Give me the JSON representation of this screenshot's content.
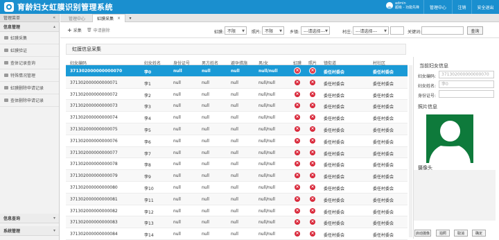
{
  "app": {
    "title": "育龄妇女虹膜识别管理系统"
  },
  "user": {
    "name": "admin",
    "role": "超级 - 功能先锋"
  },
  "topnav": [
    "管理中心",
    "注销",
    "安全退出"
  ],
  "sidebar": {
    "header": "管理菜单",
    "collapse_icon": "«",
    "section_main": "信息管理",
    "items": [
      "虹膜采集",
      "虹膜验证",
      "查体记录查询",
      "特殊情况管理",
      "虹膜删除申请记录",
      "查体删除申请记录"
    ],
    "bottom_sections": [
      "信息查询",
      "系统管理"
    ]
  },
  "tabs": [
    "管理中心",
    "虹膜采集"
  ],
  "toolbar": {
    "add_label": "采集",
    "delete_label": "申请删除",
    "filters": {
      "iris_label": "虹膜:",
      "iris_value": "不限",
      "photo_label": "照片:",
      "photo_value": "不限",
      "town_label": "乡镇:",
      "town_value": "---请选择---",
      "village_label": "村庄:",
      "village_value": "---请选择---",
      "keyword_label": "关键词:"
    },
    "search_label": "查询"
  },
  "panel": {
    "title": "虹膜信息采集"
  },
  "table": {
    "headers": [
      "妇女编码",
      "妇女姓名",
      "身份证号",
      "男方姓名",
      "避孕措施",
      "男/女",
      "虹膜",
      "照片",
      "镇街道",
      "村社区"
    ],
    "rows": [
      {
        "code": "371302000000000070",
        "name": "李0",
        "id": "null",
        "husband": "null",
        "contra": "null",
        "gender": "null/null",
        "town": "委任村委会",
        "village": "委任村委会"
      },
      {
        "code": "371302000000000071",
        "name": "李1",
        "id": "null",
        "husband": "null",
        "contra": "null",
        "gender": "null/null",
        "town": "委任村委会",
        "village": "委任村委会"
      },
      {
        "code": "371302000000000072",
        "name": "李2",
        "id": "null",
        "husband": "null",
        "contra": "null",
        "gender": "null/null",
        "town": "委任村委会",
        "village": "委任村委会"
      },
      {
        "code": "371302000000000073",
        "name": "李3",
        "id": "null",
        "husband": "null",
        "contra": "null",
        "gender": "null/null",
        "town": "委任村委会",
        "village": "委任村委会"
      },
      {
        "code": "371302000000000074",
        "name": "李4",
        "id": "null",
        "husband": "null",
        "contra": "null",
        "gender": "null/null",
        "town": "委任村委会",
        "village": "委任村委会"
      },
      {
        "code": "371302000000000075",
        "name": "李5",
        "id": "null",
        "husband": "null",
        "contra": "null",
        "gender": "null/null",
        "town": "委任村委会",
        "village": "委任村委会"
      },
      {
        "code": "371302000000000076",
        "name": "李6",
        "id": "null",
        "husband": "null",
        "contra": "null",
        "gender": "null/null",
        "town": "委任村委会",
        "village": "委任村委会"
      },
      {
        "code": "371302000000000077",
        "name": "李7",
        "id": "null",
        "husband": "null",
        "contra": "null",
        "gender": "null/null",
        "town": "委任村委会",
        "village": "委任村委会"
      },
      {
        "code": "371302000000000078",
        "name": "李8",
        "id": "null",
        "husband": "null",
        "contra": "null",
        "gender": "null/null",
        "town": "委任村委会",
        "village": "委任村委会"
      },
      {
        "code": "371302000000000079",
        "name": "李9",
        "id": "null",
        "husband": "null",
        "contra": "null",
        "gender": "null/null",
        "town": "委任村委会",
        "village": "委任村委会"
      },
      {
        "code": "371302000000000080",
        "name": "李10",
        "id": "null",
        "husband": "null",
        "contra": "null",
        "gender": "null/null",
        "town": "委任村委会",
        "village": "委任村委会"
      },
      {
        "code": "371302000000000081",
        "name": "李11",
        "id": "null",
        "husband": "null",
        "contra": "null",
        "gender": "null/null",
        "town": "委任村委会",
        "village": "委任村委会"
      },
      {
        "code": "371302000000000082",
        "name": "李12",
        "id": "null",
        "husband": "null",
        "contra": "null",
        "gender": "null/null",
        "town": "委任村委会",
        "village": "委任村委会"
      },
      {
        "code": "371302000000000083",
        "name": "李13",
        "id": "null",
        "husband": "null",
        "contra": "null",
        "gender": "null/null",
        "town": "委任村委会",
        "village": "委任村委会"
      },
      {
        "code": "371302000000000084",
        "name": "李14",
        "id": "null",
        "husband": "null",
        "contra": "null",
        "gender": "null/null",
        "town": "委任村委会",
        "village": "委任村委会"
      }
    ]
  },
  "right_panel": {
    "title": "当前妇女信息",
    "code_label": "妇女编码:",
    "code_value": "371302000000000070",
    "name_label": "妇女姓名:",
    "name_value": "李0",
    "id_label": "身份证号:",
    "id_value": "",
    "photo_title": "照片信息",
    "camera_title": "摄像头",
    "buttons": [
      "启动摄像",
      "拍照",
      "取消",
      "确定"
    ]
  },
  "colors": {
    "primary": "#1a8fcf",
    "selected_row": "#1a9ad6",
    "photo_bg": "#0e7a3b",
    "no_icon": "#d9293b"
  }
}
